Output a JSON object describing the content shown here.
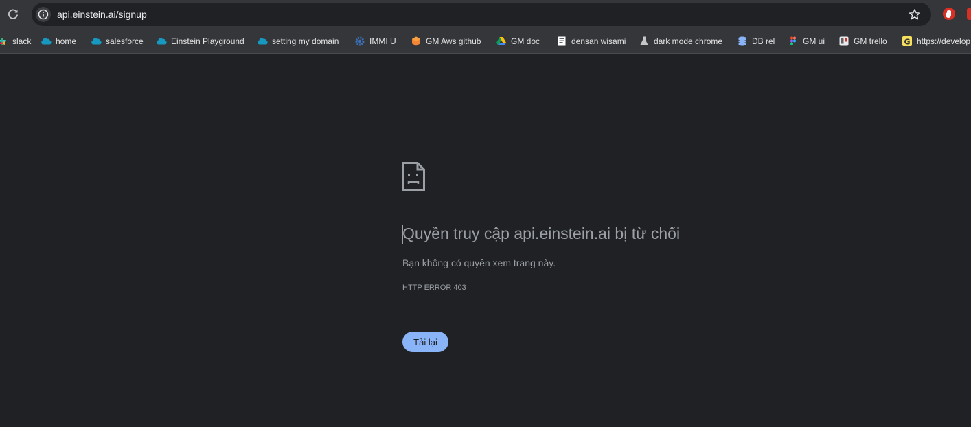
{
  "browser": {
    "url": "api.einstein.ai/signup",
    "colors": {
      "toolbar": "#35363a",
      "page_bg": "#202124",
      "accent": "#8ab4f8"
    }
  },
  "bookmarks": [
    {
      "label": "slack",
      "icon": "slack-icon"
    },
    {
      "label": "home",
      "icon": "salesforce-cloud-icon"
    },
    {
      "label": "salesforce",
      "icon": "salesforce-cloud-icon"
    },
    {
      "label": "Einstein Playground",
      "icon": "salesforce-cloud-icon"
    },
    {
      "label": "setting my domain",
      "icon": "salesforce-cloud-icon"
    },
    {
      "label": "IMMI U",
      "icon": "gear-icon"
    },
    {
      "label": "GM Aws github",
      "icon": "aws-cube-icon"
    },
    {
      "label": "GM  doc",
      "icon": "google-drive-icon"
    },
    {
      "label": "densan wisami",
      "icon": "document-icon"
    },
    {
      "label": "dark mode chrome",
      "icon": "flask-icon"
    },
    {
      "label": "DB rel",
      "icon": "database-icon"
    },
    {
      "label": "GM ui",
      "icon": "figma-icon"
    },
    {
      "label": "GM trello",
      "icon": "trello-icon"
    },
    {
      "label": "https://develop",
      "icon": "g-icon"
    }
  ],
  "error_page": {
    "title": "Quyền truy cập api.einstein.ai bị từ chối",
    "message": "Bạn không có quyền xem trang này.",
    "error_code": "HTTP ERROR 403",
    "reload_label": "Tải lại",
    "icon": "sad-page-icon"
  }
}
